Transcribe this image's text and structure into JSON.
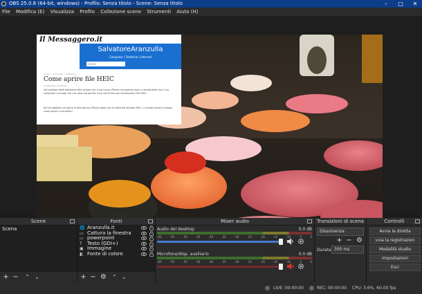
{
  "window": {
    "title": "OBS 25.0.8 (64-bit, windows) - Profilo: Senza titolo - Scene: Senza titolo"
  },
  "menu": [
    "File",
    "Modifica (E)",
    "Visualizza",
    "Profilo",
    "Collezione scene",
    "Strumenti",
    "Aiuto (H)"
  ],
  "webpage": {
    "logo": "Il Messaggero.it",
    "brand": "SalvatoreAranzulla",
    "nav_links": "Computer | Telefonia | Internet",
    "search_placeholder": "Cerca",
    "breadcrumb": "Home > Computer > Software > ...",
    "headline": "Come aprire file HEIC",
    "byline": "di Salvatore Aranzulla",
    "paragraph1": "Hai scattato delle bellissime foto ricordo con il tuo nuovo iPhone ma quando provi a condividerle con il tuo computer ti accorgi che non riesci ad aprirle: ecco come fare per visualizzare i file HEIC.",
    "paragraph2": "Se hai problemi ad aprire le foto del tuo iPhone sappi che si tratta del formato HEIC. In questa guida ti spiego come aprirli e convertirli."
  },
  "docks": {
    "scenes": {
      "title": "Scene",
      "items": [
        "Scena"
      ]
    },
    "sources": {
      "title": "Fonti",
      "items": [
        {
          "label": "Aranzulla.it",
          "icon": "browser-source-icon"
        },
        {
          "label": "Cattura la finestra",
          "icon": "window-capture-icon"
        },
        {
          "label": "powerpoint",
          "icon": "window-capture-icon"
        },
        {
          "label": "Testo (GDI+)",
          "icon": "text-icon"
        },
        {
          "label": "Immagine",
          "icon": "image-icon"
        },
        {
          "label": "Fonte di colore",
          "icon": "color-source-icon"
        }
      ]
    },
    "mixer": {
      "title": "Mixer audio",
      "channels": [
        {
          "name": "Audio del desktop",
          "db": "0.0 dB",
          "volume": 1.0,
          "muted": false
        },
        {
          "name": "Microfono/disp. ausiliario",
          "db": "0.0 dB",
          "volume": 1.0,
          "muted": true
        }
      ],
      "ticks": [
        "-60",
        "-55",
        "-50",
        "-45",
        "-40",
        "-35",
        "-30",
        "-25",
        "-20",
        "-15",
        "-10",
        "-5",
        "0"
      ]
    },
    "transitions": {
      "title": "Transizioni di scena",
      "selected": "Dissolvenza",
      "duration_label": "Durata",
      "duration_value": "300 ms"
    },
    "controls": {
      "title": "Controlli",
      "buttons": [
        "Avvia la diretta",
        "vvia la registrazion",
        "Modalità studio",
        "Impostazioni",
        "Esci"
      ]
    }
  },
  "status": {
    "live": "LIVE: 00:00:00",
    "rec": "REC: 00:00:00",
    "cpu": "CPU: 3.6%, 60.00 fps"
  },
  "colors": {
    "titlebar": "#0d3e8a",
    "accent": "#4b7ad3",
    "mute_red": "#d9302c"
  }
}
